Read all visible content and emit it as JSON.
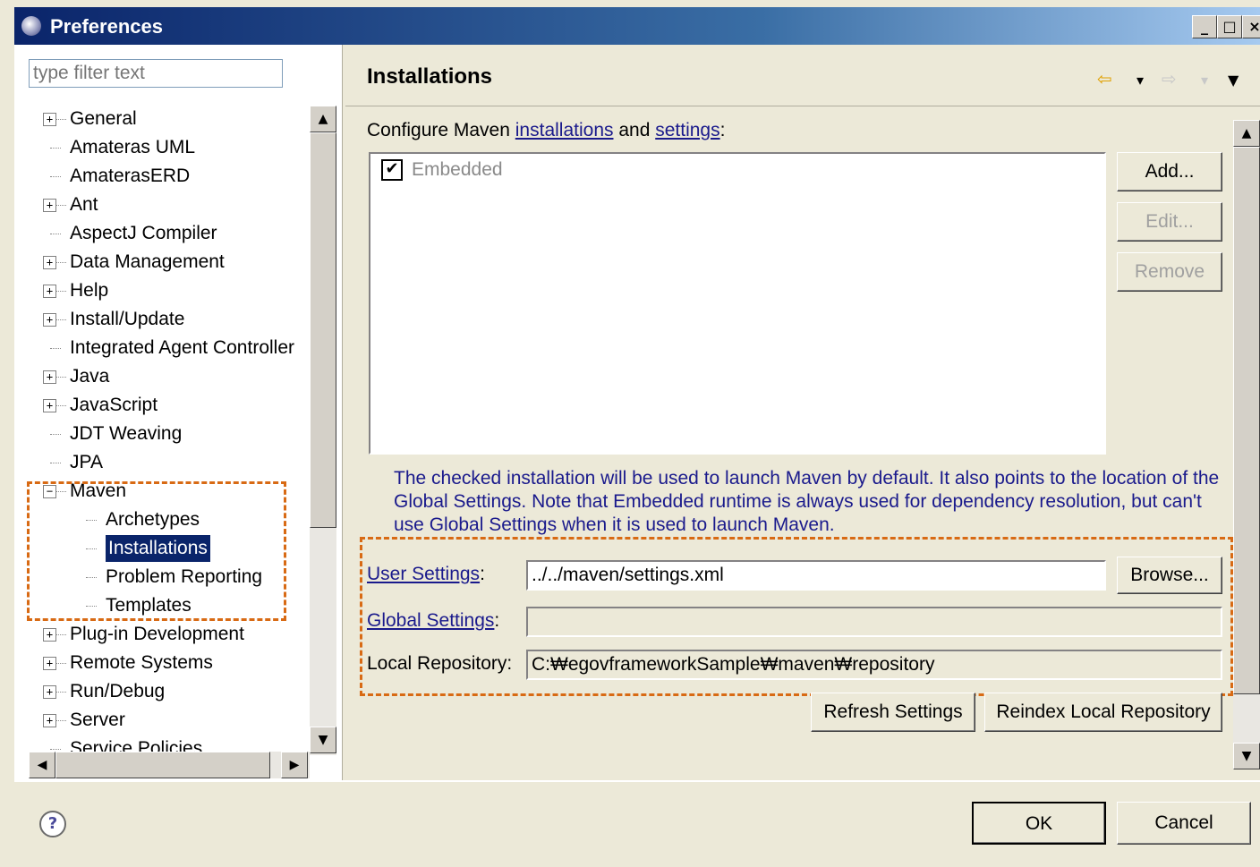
{
  "window": {
    "title": "Preferences",
    "controls": [
      "_",
      "□",
      "×"
    ]
  },
  "filter": {
    "placeholder": "type filter text"
  },
  "tree": {
    "items": [
      {
        "label": "General",
        "expander": "+"
      },
      {
        "label": "Amateras UML",
        "expander": ""
      },
      {
        "label": "AmaterasERD",
        "expander": ""
      },
      {
        "label": "Ant",
        "expander": "+"
      },
      {
        "label": "AspectJ Compiler",
        "expander": ""
      },
      {
        "label": "Data Management",
        "expander": "+"
      },
      {
        "label": "Help",
        "expander": "+"
      },
      {
        "label": "Install/Update",
        "expander": "+"
      },
      {
        "label": "Integrated Agent Controller",
        "expander": ""
      },
      {
        "label": "Java",
        "expander": "+"
      },
      {
        "label": "JavaScript",
        "expander": "+"
      },
      {
        "label": "JDT Weaving",
        "expander": ""
      },
      {
        "label": "JPA",
        "expander": ""
      },
      {
        "label": "Maven",
        "expander": "−"
      },
      {
        "label": "Archetypes",
        "expander": "",
        "child": true
      },
      {
        "label": "Installations",
        "expander": "",
        "child": true,
        "selected": true
      },
      {
        "label": "Problem Reporting",
        "expander": "",
        "child": true
      },
      {
        "label": "Templates",
        "expander": "",
        "child": true
      },
      {
        "label": "Plug-in Development",
        "expander": "+"
      },
      {
        "label": "Remote Systems",
        "expander": "+"
      },
      {
        "label": "Run/Debug",
        "expander": "+"
      },
      {
        "label": "Server",
        "expander": "+"
      },
      {
        "label": "Service Policies",
        "expander": ""
      }
    ]
  },
  "page": {
    "title": "Installations",
    "nav": {
      "back_icon": "⇦",
      "forward_icon": "⇨",
      "dropdown": "▾",
      "menu": "▼"
    },
    "configure_prefix": "Configure Maven ",
    "configure_link1": "installations",
    "configure_and": " and ",
    "configure_link2": "settings",
    "configure_suffix": ":",
    "installation": {
      "label": "Embedded",
      "checked": "✔"
    },
    "buttons": {
      "add": "Add...",
      "edit": "Edit...",
      "remove": "Remove",
      "browse": "Browse...",
      "refresh": "Refresh Settings",
      "reindex": "Reindex Local Repository"
    },
    "description": "The checked installation will be used to launch Maven by default. It also points to the location of the Global Settings. Note that Embedded runtime is always used for dependency resolution, but can't use Global Settings when it is used to launch Maven.",
    "user_settings_label": "User Settings",
    "user_settings_value": "../../maven/settings.xml",
    "global_settings_label": "Global Settings",
    "global_settings_value": "",
    "local_repo_label": "Local Repository:",
    "local_repo_value": "C:₩egovframeworkSample₩maven₩repository"
  },
  "footer": {
    "help_icon": "?",
    "ok": "OK",
    "cancel": "Cancel"
  },
  "colors": {
    "highlight_dash": "#d86a14",
    "link": "#1a1a8c",
    "selection": "#0a246a"
  }
}
